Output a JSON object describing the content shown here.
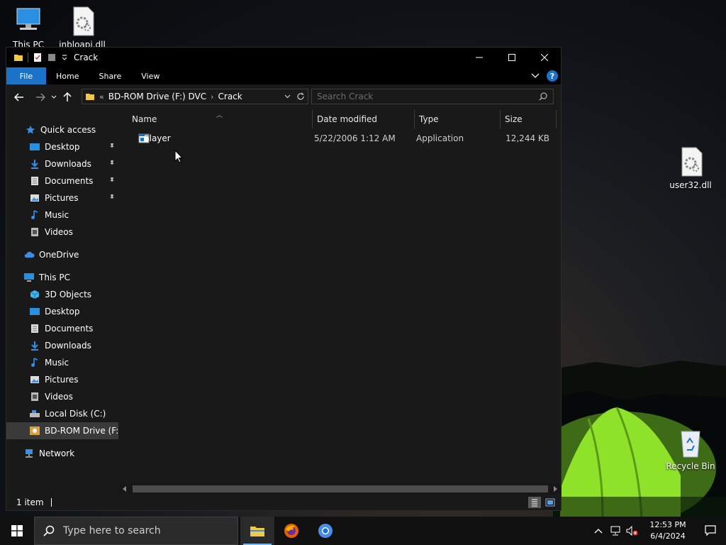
{
  "desktop": {
    "icons": [
      {
        "label": "This PC",
        "icon": "this-pc-icon"
      },
      {
        "label": "inbloapi.dll",
        "icon": "dll-file-icon"
      },
      {
        "label": "user32.dll",
        "icon": "dll-file-icon"
      },
      {
        "label": "Recycle Bin",
        "icon": "recycle-bin-icon"
      }
    ]
  },
  "window": {
    "title": "Crack",
    "ribbon_tabs": [
      "File",
      "Home",
      "Share",
      "View"
    ],
    "address": {
      "overflow": "«",
      "crumbs": [
        "BD-ROM Drive (F:) DVC",
        "Crack"
      ]
    },
    "search": {
      "placeholder": "Search Crack"
    },
    "nav_pane": {
      "quick_access": "Quick access",
      "pinned": [
        "Desktop",
        "Downloads",
        "Documents",
        "Pictures"
      ],
      "unpinned": [
        "Music",
        "Videos"
      ],
      "onedrive": "OneDrive",
      "this_pc": "This PC",
      "this_pc_items": [
        "3D Objects",
        "Desktop",
        "Documents",
        "Downloads",
        "Music",
        "Pictures",
        "Videos",
        "Local Disk (C:)",
        "BD-ROM Drive (F:) D"
      ],
      "network": "Network"
    },
    "columns": {
      "name": "Name",
      "date": "Date modified",
      "type": "Type",
      "size": "Size"
    },
    "files": [
      {
        "name": "Slayer",
        "date": "5/22/2006 1:12 AM",
        "type": "Application",
        "size": "12,244 KB"
      }
    ],
    "status": {
      "count": "1 item"
    }
  },
  "taskbar": {
    "search_placeholder": "Type here to search",
    "clock": {
      "time": "12:53 PM",
      "date": "6/4/2024"
    }
  },
  "colors": {
    "accent": "#1a73c9",
    "window_bg": "#191919",
    "titlebar_bg": "#000000",
    "tent_green": "#7ed321"
  }
}
